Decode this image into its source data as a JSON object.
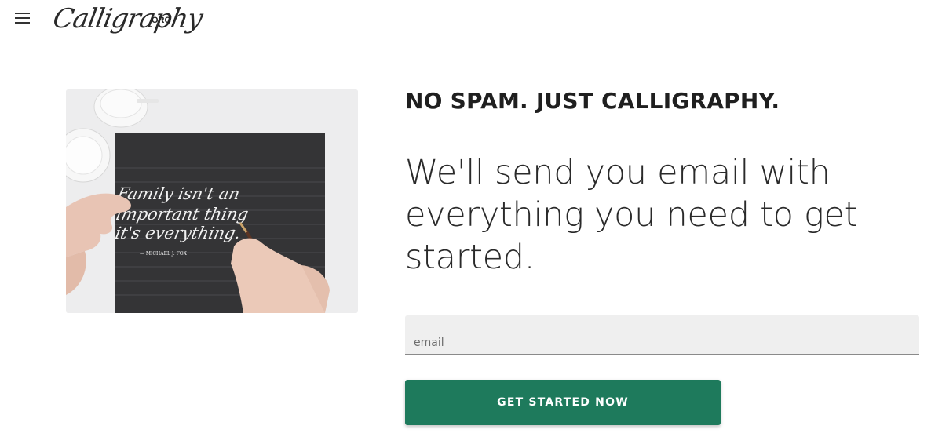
{
  "header": {
    "menu_icon": "hamburger-menu-icon",
    "logo_script": "Calligraphy",
    "logo_suffix": "ORG"
  },
  "hero": {
    "image": "calligraphy-on-dark-paper-photo",
    "image_text_lines": [
      "Family isn't an",
      "important thing",
      "it's everything.",
      "— MICHAEL J. FOX"
    ]
  },
  "signup": {
    "headline": "NO SPAM. JUST CALLIGRAPHY.",
    "subtitle": "We'll send you email with everything you need to get started.",
    "email_placeholder": "email",
    "email_value": "",
    "cta_label": "GET STARTED NOW"
  },
  "colors": {
    "cta_background": "#1e7a5c",
    "field_background": "#efefef",
    "text_dark": "#1f1f1f"
  }
}
